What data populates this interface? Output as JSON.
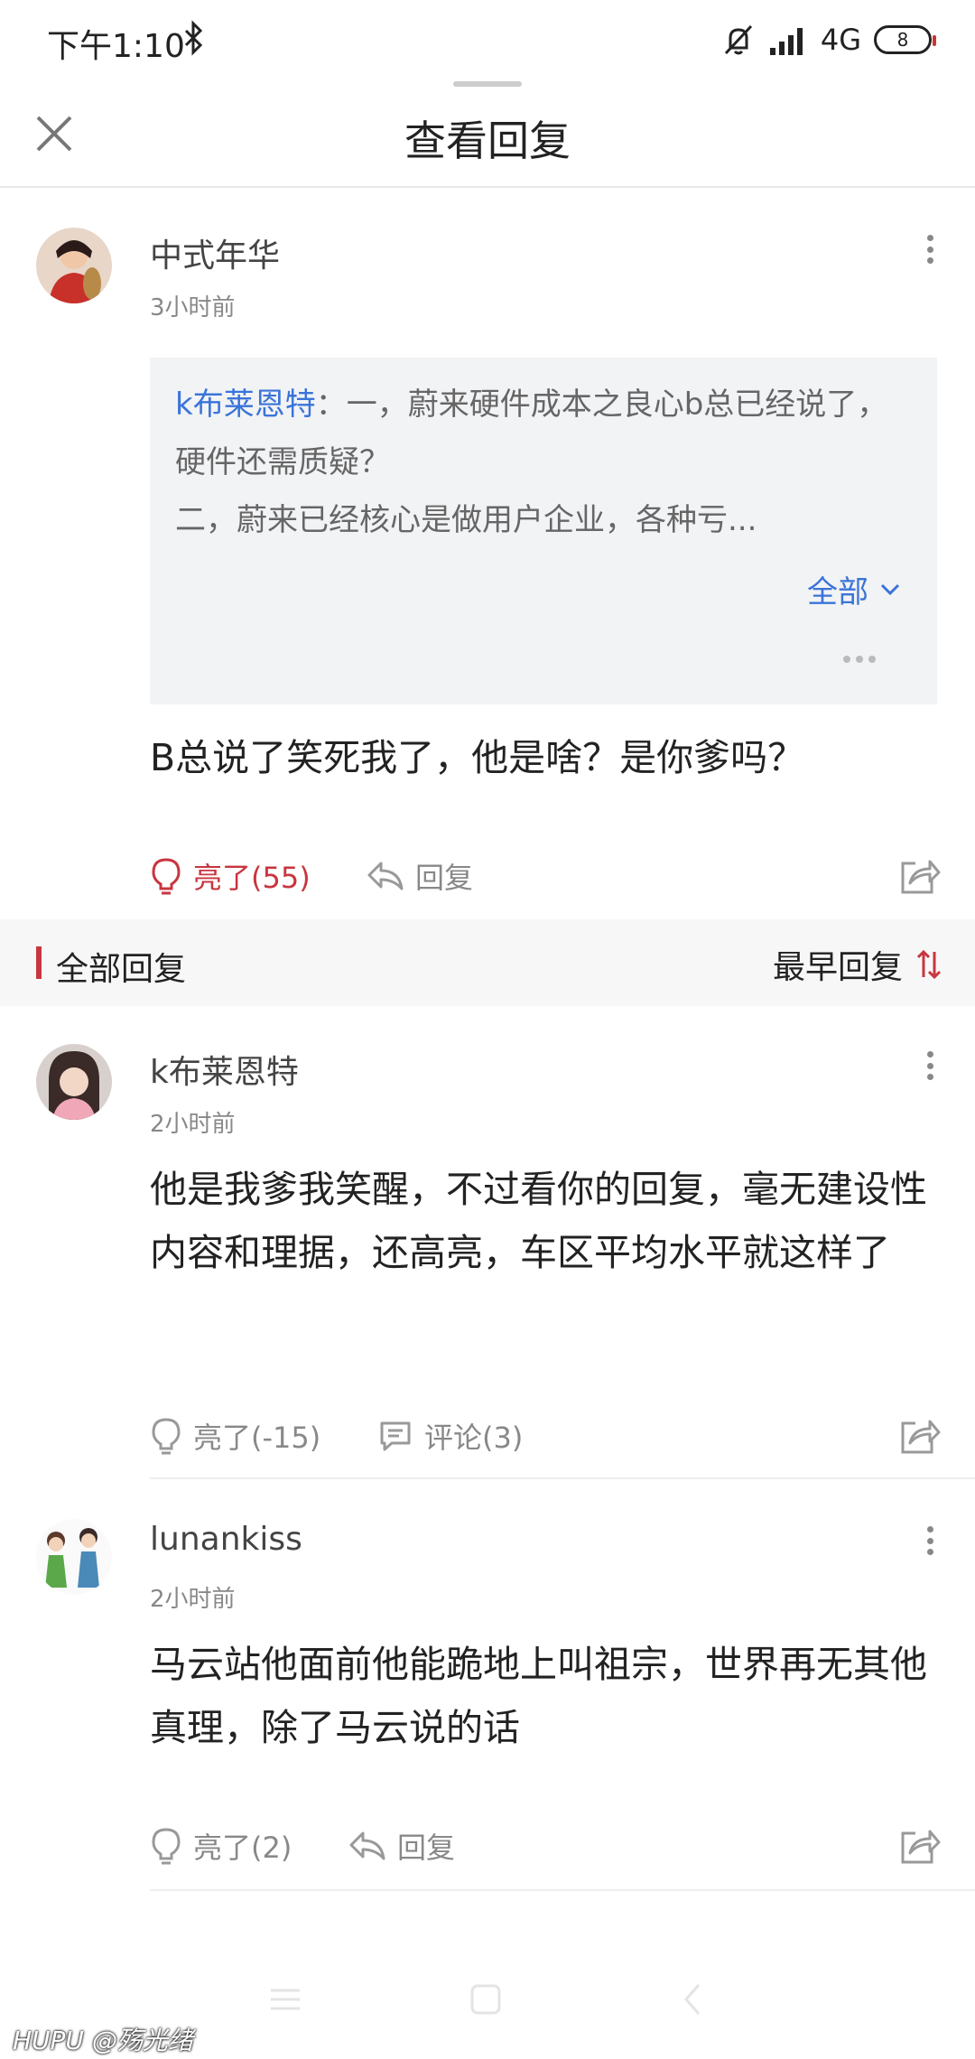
{
  "status": {
    "time": "下午1:10",
    "network": "4G",
    "battery": "8"
  },
  "header": {
    "title": "查看回复"
  },
  "main_comment": {
    "username": "中式年华",
    "time": "3小时前",
    "quote": {
      "user": "k布莱恩特",
      "separator": "：",
      "text": "一，蔚来硬件成本之良心b总已经说了，硬件还需质疑？\n二，蔚来已经核心是做用户企业，各种亏...",
      "expand_label": "全部"
    },
    "body": "B总说了笑死我了，他是啥？是你爹吗？",
    "like_label": "亮了(55)",
    "reply_label": "回复"
  },
  "section": {
    "title": "全部回复",
    "sort_label": "最早回复"
  },
  "replies": [
    {
      "username": "k布莱恩特",
      "time": "2小时前",
      "body": "他是我爹我笑醒，不过看你的回复，毫无建设性内容和理据，还高亮，车区平均水平就这样了",
      "like_label": "亮了(-15)",
      "second_action": "评论(3)"
    },
    {
      "username": "lunankiss",
      "time": "2小时前",
      "body": "马云站他面前他能跪地上叫祖宗，世界再无其他真理，除了马云说的话",
      "like_label": "亮了(2)",
      "second_action": "回复"
    }
  ],
  "watermark": "HUPU @殇光绪",
  "colors": {
    "accent": "#c8363f",
    "link": "#3a74d9"
  },
  "icons": [
    "bluetooth-icon",
    "mute-icon",
    "signal-icon",
    "battery-icon",
    "close-icon",
    "more-icon",
    "chevron-down-icon",
    "lightbulb-icon",
    "reply-arrow-icon",
    "comment-icon",
    "share-icon",
    "sort-icon",
    "menu-nav-icon",
    "home-nav-icon",
    "back-nav-icon"
  ]
}
